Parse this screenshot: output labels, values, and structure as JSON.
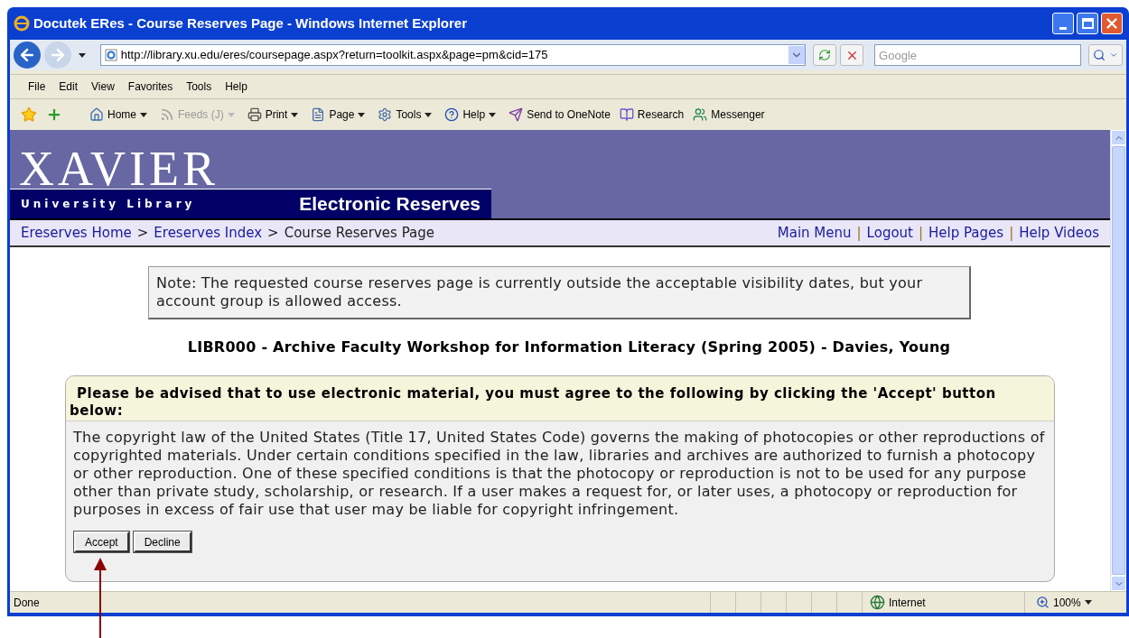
{
  "window": {
    "title": "Docutek ERes - Course Reserves Page - Windows Internet Explorer"
  },
  "address": {
    "url": "http://library.xu.edu/eres/coursepage.aspx?return=toolkit.aspx&page=pm&cid=175"
  },
  "search": {
    "placeholder": "Google"
  },
  "menu": [
    "File",
    "Edit",
    "View",
    "Favorites",
    "Tools",
    "Help"
  ],
  "toolbar": [
    {
      "label": "Home",
      "dropdown": true,
      "disabled": false
    },
    {
      "label": "Feeds (J)",
      "dropdown": true,
      "disabled": true
    },
    {
      "label": "Print",
      "dropdown": true,
      "disabled": false
    },
    {
      "label": "Page",
      "dropdown": true,
      "disabled": false
    },
    {
      "label": "Tools",
      "dropdown": true,
      "disabled": false
    },
    {
      "label": "Help",
      "dropdown": true,
      "disabled": false
    },
    {
      "label": "Send to OneNote",
      "dropdown": false,
      "disabled": false
    },
    {
      "label": "Research",
      "dropdown": false,
      "disabled": false
    },
    {
      "label": "Messenger",
      "dropdown": false,
      "disabled": false
    }
  ],
  "header": {
    "logo": "XAVIER",
    "subtitle": "University Library",
    "banner": "Electronic Reserves"
  },
  "breadcrumb": {
    "links": [
      "Ereserves Home",
      "Ereserves Index"
    ],
    "separator": ">",
    "current": "Course Reserves Page"
  },
  "nav_links": [
    "Main Menu",
    "Logout",
    "Help Pages",
    "Help Videos"
  ],
  "nav_separator": "|",
  "note": "Note: The requested course reserves page is currently outside the acceptable visibility dates, but your account group is allowed access.",
  "course_title": "LIBR000 - Archive Faculty Workshop for Information Literacy (Spring 2005) - Davies, Young",
  "notice": {
    "heading": "Please be advised that to use electronic material, you must agree to the following by clicking the 'Accept' button below:",
    "body": "The copyright law of the United States (Title 17, United States Code) governs the making of photocopies or other reproductions of copyrighted materials. Under certain conditions specified in the law, libraries and archives are authorized to furnish a photocopy or other reproduction. One of these specified conditions is that the photocopy or reproduction is not to be used for any purpose other than private study, scholarship, or research. If a user makes a request for, or later uses, a photocopy or reproduction for purposes in excess of fair use that user may be liable for copyright infringement.",
    "buttons": [
      "Accept",
      "Decline"
    ]
  },
  "status_bar": {
    "text": "Done",
    "zone": "Internet",
    "zoom": "100%"
  }
}
